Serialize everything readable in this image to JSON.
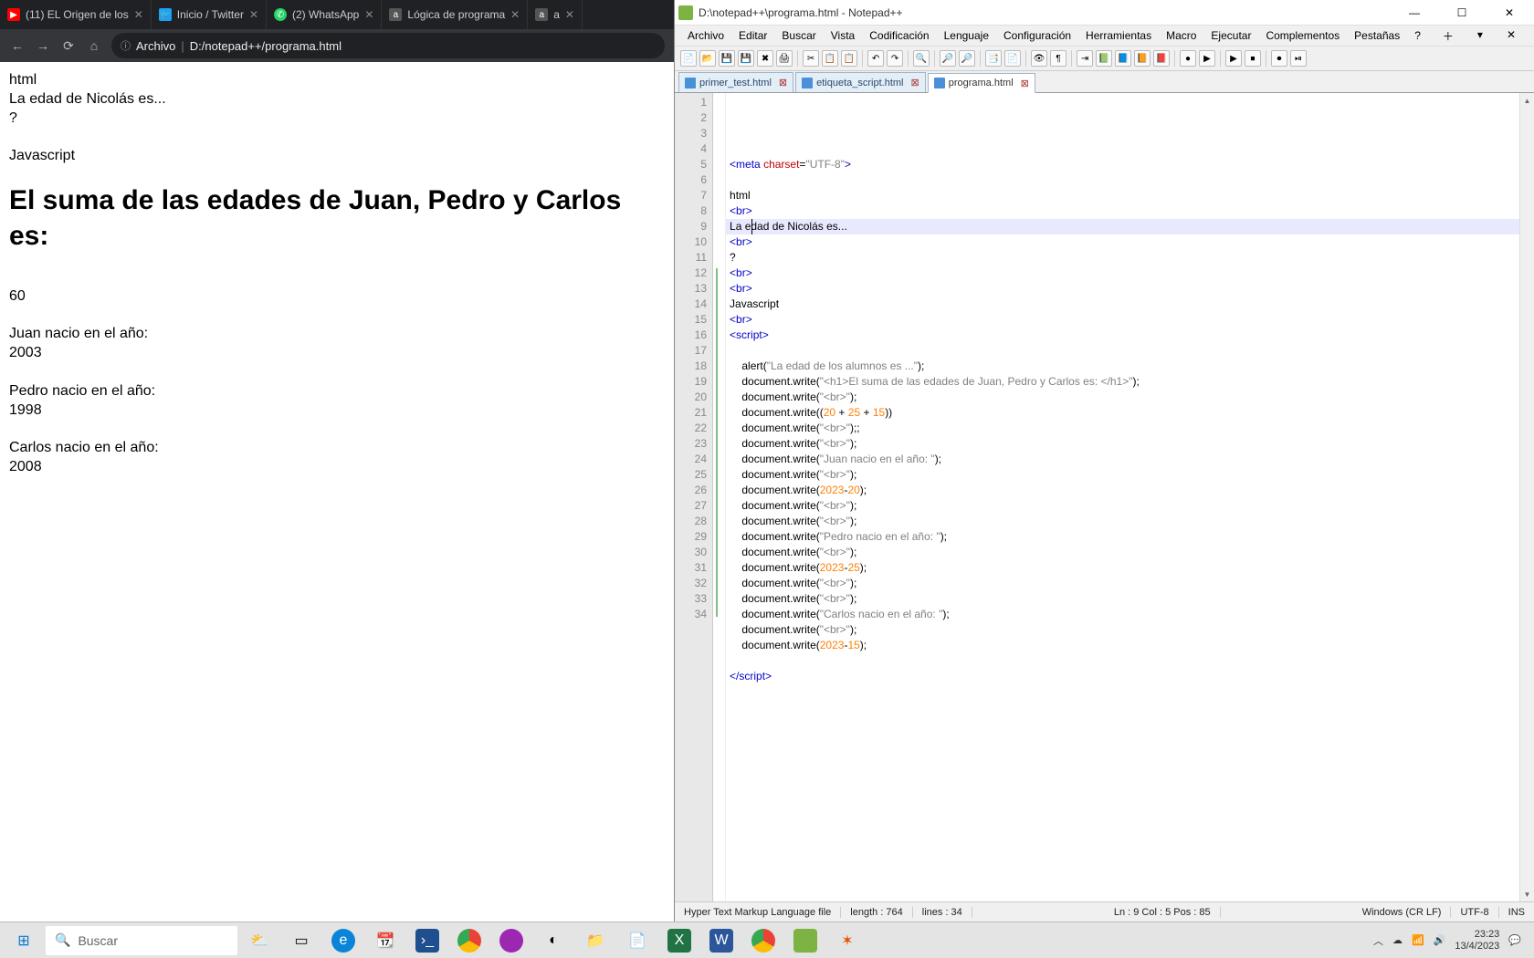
{
  "chrome": {
    "tabs": [
      {
        "title": "(11) EL Origen de los",
        "favicon": "yt"
      },
      {
        "title": "Inicio / Twitter",
        "favicon": "tw"
      },
      {
        "title": "(2) WhatsApp",
        "favicon": "wa"
      },
      {
        "title": "Lógica de programa",
        "favicon": "a"
      },
      {
        "title": "a",
        "favicon": "a"
      }
    ],
    "omnibox": {
      "protocolLabel": "Archivo",
      "path": "D:/notepad++/programa.html"
    },
    "page": {
      "lines1": [
        "html",
        "La edad de Nicolás es...",
        "?"
      ],
      "line2": "Javascript",
      "h1": "El suma de las edades de Juan, Pedro y Carlos es:",
      "sum": "60",
      "blocks": [
        {
          "label": "Juan nacio en el año:",
          "value": "2003"
        },
        {
          "label": "Pedro nacio en el año:",
          "value": "1998"
        },
        {
          "label": "Carlos nacio en el año:",
          "value": "2008"
        }
      ]
    }
  },
  "npp": {
    "title": "D:\\notepad++\\programa.html - Notepad++",
    "menu": [
      "Archivo",
      "Editar",
      "Buscar",
      "Vista",
      "Codificación",
      "Lenguaje",
      "Configuración",
      "Herramientas",
      "Macro",
      "Ejecutar",
      "Complementos",
      "Pestañas",
      "?"
    ],
    "docTabs": [
      {
        "name": "primer_test.html",
        "active": false
      },
      {
        "name": "etiqueta_script.html",
        "active": false
      },
      {
        "name": "programa.html",
        "active": true
      }
    ],
    "status": {
      "fileType": "Hyper Text Markup Language file",
      "length": "length : 764",
      "lines": "lines : 34",
      "cursor": "Ln : 9   Col : 5   Pos : 85",
      "eol": "Windows (CR LF)",
      "enc": "UTF-8",
      "mode": "INS"
    },
    "code": [
      {
        "n": 1,
        "html": "<span class='k'>&lt;meta</span> <span class='attr'>charset</span>=<span class='str'>\"UTF-8\"</span><span class='k'>&gt;</span>"
      },
      {
        "n": 2,
        "html": ""
      },
      {
        "n": 3,
        "html": "html"
      },
      {
        "n": 4,
        "html": "<span class='k'>&lt;br&gt;</span>"
      },
      {
        "n": 5,
        "html": "La edad de Nicolás es..."
      },
      {
        "n": 6,
        "html": "<span class='k'>&lt;br&gt;</span>"
      },
      {
        "n": 7,
        "html": "?"
      },
      {
        "n": 8,
        "html": "<span class='k'>&lt;br&gt;</span>"
      },
      {
        "n": 9,
        "html": "<span class='k'>&lt;br&gt;</span>"
      },
      {
        "n": 10,
        "html": "Javascript"
      },
      {
        "n": 11,
        "html": "<span class='k'>&lt;br&gt;</span>"
      },
      {
        "n": 12,
        "html": "<span class='k'>&lt;script&gt;</span>"
      },
      {
        "n": 13,
        "html": ""
      },
      {
        "n": 14,
        "html": "    alert(<span class='str'>\"La edad de los alumnos es ...\"</span>);"
      },
      {
        "n": 15,
        "html": "    document.write(<span class='str'>\"&lt;h1&gt;El suma de las edades de Juan, Pedro y Carlos es: &lt;/h1&gt;\"</span>);"
      },
      {
        "n": 16,
        "html": "    document.write(<span class='str'>\"&lt;br&gt;\"</span>);"
      },
      {
        "n": 17,
        "html": "    document.write((<span class='num'>20</span> + <span class='num'>25</span> + <span class='num'>15</span>))"
      },
      {
        "n": 18,
        "html": "    document.write(<span class='str'>\"&lt;br&gt;\"</span>);;"
      },
      {
        "n": 19,
        "html": "    document.write(<span class='str'>\"&lt;br&gt;\"</span>);"
      },
      {
        "n": 20,
        "html": "    document.write(<span class='str'>\"Juan nacio en el año: \"</span>);"
      },
      {
        "n": 21,
        "html": "    document.write(<span class='str'>\"&lt;br&gt;\"</span>);"
      },
      {
        "n": 22,
        "html": "    document.write(<span class='num'>2023</span>-<span class='num'>20</span>);"
      },
      {
        "n": 23,
        "html": "    document.write(<span class='str'>\"&lt;br&gt;\"</span>);"
      },
      {
        "n": 24,
        "html": "    document.write(<span class='str'>\"&lt;br&gt;\"</span>);"
      },
      {
        "n": 25,
        "html": "    document.write(<span class='str'>\"Pedro nacio en el año: \"</span>);"
      },
      {
        "n": 26,
        "html": "    document.write(<span class='str'>\"&lt;br&gt;\"</span>);"
      },
      {
        "n": 27,
        "html": "    document.write(<span class='num'>2023</span>-<span class='num'>25</span>);"
      },
      {
        "n": 28,
        "html": "    document.write(<span class='str'>\"&lt;br&gt;\"</span>);"
      },
      {
        "n": 29,
        "html": "    document.write(<span class='str'>\"&lt;br&gt;\"</span>);"
      },
      {
        "n": 30,
        "html": "    document.write(<span class='str'>\"Carlos nacio en el año: \"</span>);"
      },
      {
        "n": 31,
        "html": "    document.write(<span class='str'>\"&lt;br&gt;\"</span>);"
      },
      {
        "n": 32,
        "html": "    document.write(<span class='num'>2023</span>-<span class='num'>15</span>);"
      },
      {
        "n": 33,
        "html": ""
      },
      {
        "n": 34,
        "html": "<span class='k'>&lt;/script&gt;</span>"
      }
    ]
  },
  "taskbar": {
    "search_placeholder": "Buscar",
    "time": "23:23",
    "date": "13/4/2023"
  }
}
